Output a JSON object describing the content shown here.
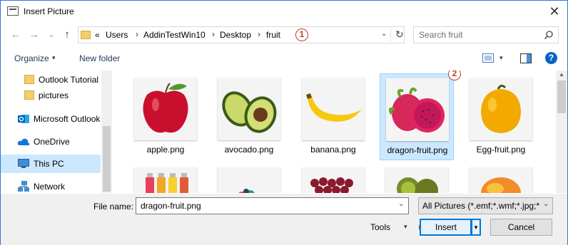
{
  "window": {
    "title": "Insert Picture",
    "close_glyph": "✕"
  },
  "nav": {
    "back_glyph": "←",
    "forward_glyph": "→",
    "recent_glyph": "⌄",
    "up_glyph": "↑",
    "breadcrumb_overflow": "«",
    "breadcrumb": [
      "Users",
      "AddinTestWin10",
      "Desktop",
      "fruit"
    ],
    "separator": "›",
    "dropdown_glyph": "⌄",
    "refresh_glyph": "↻"
  },
  "search": {
    "placeholder": "Search fruit"
  },
  "toolbar": {
    "organize_label": "Organize",
    "new_folder_label": "New folder",
    "dropdown_glyph": "▾",
    "help_glyph": "?"
  },
  "annotations": {
    "step1": "1",
    "step2": "2",
    "step3": "3"
  },
  "sidebar": {
    "items": [
      {
        "label": "Outlook Tutorial",
        "icon": "folder-icon"
      },
      {
        "label": "pictures",
        "icon": "folder-icon"
      },
      {
        "label": "Microsoft Outlook",
        "icon": "outlook-icon"
      },
      {
        "label": "OneDrive",
        "icon": "cloud-icon"
      },
      {
        "label": "This PC",
        "icon": "computer-icon",
        "selected": true
      },
      {
        "label": "Network",
        "icon": "network-icon"
      }
    ]
  },
  "files": [
    {
      "name": "apple.png",
      "icon": "apple-image"
    },
    {
      "name": "avocado.png",
      "icon": "avocado-image"
    },
    {
      "name": "banana.png",
      "icon": "banana-image"
    },
    {
      "name": "dragon-fruit.png",
      "icon": "dragon-fruit-image",
      "selected": true
    },
    {
      "name": "Egg-fruit.png",
      "icon": "egg-fruit-image"
    }
  ],
  "files_row2": [
    {
      "icon": "juice-bottles-image"
    },
    {
      "icon": "fruit-mix-image"
    },
    {
      "icon": "grapes-image"
    },
    {
      "icon": "kiwi-image"
    },
    {
      "icon": "mango-image"
    }
  ],
  "footer": {
    "filename_label": "File name:",
    "filename_value": "dragon-fruit.png",
    "filter_value": "All Pictures (*.emf;*.wmf;*.jpg;*",
    "tools_label": "Tools",
    "insert_label": "Insert",
    "cancel_label": "Cancel",
    "dropdown_glyph": "⌄",
    "split_glyph": "▾"
  },
  "colors": {
    "selection": "#cce8ff",
    "accent": "#0078d7",
    "badge": "#c0392b",
    "link": "#1e395b"
  }
}
